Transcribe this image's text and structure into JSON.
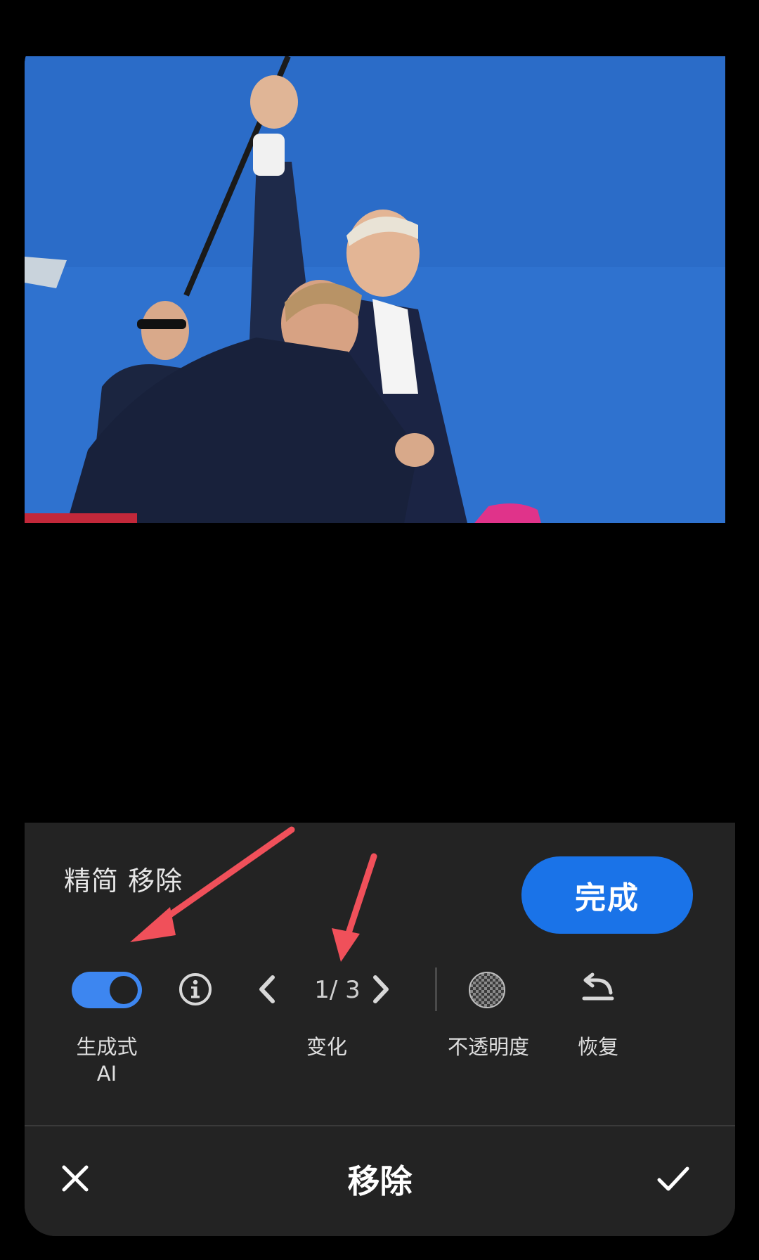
{
  "panel": {
    "title": "精简 移除",
    "done_label": "完成"
  },
  "tools": {
    "generative_ai_label": "生成式\nAI",
    "generative_ai_enabled": true,
    "variation_counter": "1/ 3",
    "variation_label": "变化",
    "opacity_label": "不透明度",
    "restore_label": "恢复"
  },
  "bottom_bar": {
    "title": "移除"
  },
  "colors": {
    "accent": "#1a73e8",
    "toggle_on": "#3d86f0",
    "annotation_arrow": "#f0505a"
  },
  "icons": [
    "info-icon",
    "chevron-left-icon",
    "chevron-right-icon",
    "opacity-checker-icon",
    "undo-icon",
    "close-icon",
    "check-icon"
  ]
}
